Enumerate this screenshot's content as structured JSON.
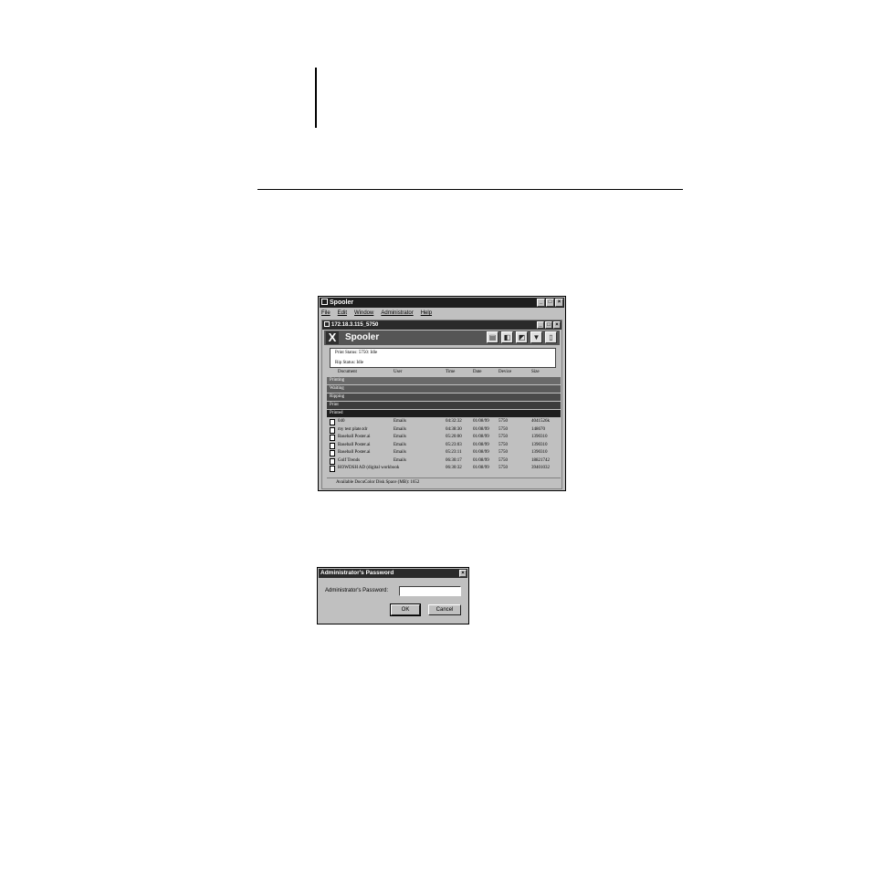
{
  "spooler_window": {
    "title": "Spooler",
    "menu": [
      "File",
      "Edit",
      "Window",
      "Administrator",
      "Help"
    ],
    "inner_title": "172.18.3.115_5750",
    "banner": {
      "logo": "X",
      "title": "Spooler"
    },
    "tool_icons": [
      "print-icon",
      "hold-icon",
      "process-icon",
      "delete-icon",
      "trash-icon"
    ],
    "status": {
      "print": "Print Status:    5750: Idle",
      "rip": "Rip Status: Idle"
    },
    "columns": [
      "Document",
      "User",
      "Time",
      "Date",
      "Device",
      "Size"
    ],
    "queues": [
      "Printing",
      "Waiting",
      "Ripping",
      "Print",
      "Printed"
    ],
    "jobs": [
      {
        "document": "040",
        "user": "Emails",
        "time": "04:32:32",
        "date": "01/08/99",
        "device": "5750",
        "size": "4041526k"
      },
      {
        "document": "my test plate.tdr",
        "user": "Emails",
        "time": "04:38:30",
        "date": "01/08/99",
        "device": "5750",
        "size": "148670"
      },
      {
        "document": "Baseball Poster.ai",
        "user": "Emails",
        "time": "05:20:00",
        "date": "01/08/99",
        "device": "5750",
        "size": "1390310"
      },
      {
        "document": "Baseball Poster.ai",
        "user": "Emails",
        "time": "05:23:03",
        "date": "01/08/99",
        "device": "5750",
        "size": "1390310"
      },
      {
        "document": "Baseball Poster.ai",
        "user": "Emails",
        "time": "05:23:11",
        "date": "01/08/99",
        "device": "5750",
        "size": "1390310"
      },
      {
        "document": "Golf Trends",
        "user": "Emails",
        "time": "06:30:17",
        "date": "01/08/99",
        "device": "5750",
        "size": "18821742"
      },
      {
        "document": "HOWDSH AD (digital workbook",
        "user": "",
        "time": "06:30:32",
        "date": "01/08/99",
        "device": "5750",
        "size": "39401032"
      }
    ],
    "footer": "Available DocuColor Disk Space (MB): 1652"
  },
  "password_dialog": {
    "title": "Administrator's Password",
    "label": "Administrator's Password:",
    "value": "",
    "ok": "OK",
    "cancel": "Cancel"
  }
}
